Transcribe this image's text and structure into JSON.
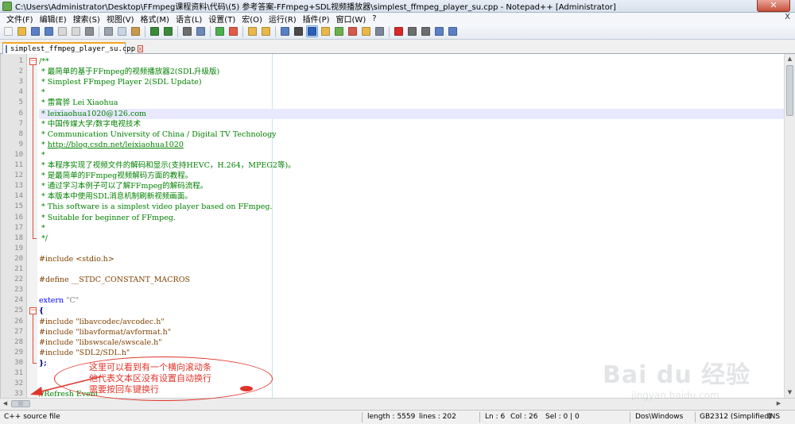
{
  "window": {
    "title": "C:\\Users\\Administrator\\Desktop\\FFmpeg课程资料\\代码\\(5) 参考答案-FFmpeg+SDL视频播放器\\simplest_ffmpeg_player_su.cpp - Notepad++ [Administrator]",
    "close_glyph": "✕"
  },
  "menu": {
    "items": [
      "文件(F)",
      "编辑(E)",
      "搜索(S)",
      "视图(V)",
      "格式(M)",
      "语言(L)",
      "设置(T)",
      "宏(O)",
      "运行(R)",
      "插件(P)",
      "窗口(W)",
      "?"
    ],
    "close_glyph": "X"
  },
  "toolbar": {
    "buttons": [
      {
        "icon": "new-file-icon",
        "color": "#f4f4f4"
      },
      {
        "icon": "open-file-icon",
        "color": "#e8b94a"
      },
      {
        "icon": "save-icon",
        "color": "#5b7fc4"
      },
      {
        "icon": "save-all-icon",
        "color": "#5b7fc4"
      },
      {
        "icon": "close-file-icon",
        "color": "#d8d8d8"
      },
      {
        "icon": "close-all-icon",
        "color": "#d8d8d8"
      },
      {
        "icon": "print-icon",
        "color": "#8a8f96"
      },
      {
        "sep": true
      },
      {
        "icon": "cut-icon",
        "color": "#9aa3ad"
      },
      {
        "icon": "copy-icon",
        "color": "#c8d4e4"
      },
      {
        "icon": "paste-icon",
        "color": "#c99a4e"
      },
      {
        "sep": true
      },
      {
        "icon": "undo-icon",
        "color": "#3a8a3a"
      },
      {
        "icon": "redo-icon",
        "color": "#3a8a3a"
      },
      {
        "sep": true
      },
      {
        "icon": "find-icon",
        "color": "#6d6d6d"
      },
      {
        "icon": "replace-icon",
        "color": "#6d87b8"
      },
      {
        "sep": true
      },
      {
        "icon": "zoom-in-icon",
        "color": "#4caf50"
      },
      {
        "icon": "zoom-out-icon",
        "color": "#e05a4a"
      },
      {
        "sep": true
      },
      {
        "icon": "sync-vertical-icon",
        "color": "#e8b94a"
      },
      {
        "icon": "sync-horizontal-icon",
        "color": "#e8b94a"
      },
      {
        "sep": true
      },
      {
        "icon": "word-wrap-icon",
        "color": "#5b7fc4"
      },
      {
        "icon": "show-all-chars-icon",
        "color": "#4a4a4a"
      },
      {
        "icon": "indent-guide-icon",
        "color": "#2d5fb8",
        "active": true
      },
      {
        "icon": "udl-icon",
        "color": "#e8b94a"
      },
      {
        "icon": "doc-map-icon",
        "color": "#6ab04c"
      },
      {
        "icon": "function-list-icon",
        "color": "#d85a4a"
      },
      {
        "icon": "folder-workspace-icon",
        "color": "#e8b94a"
      },
      {
        "icon": "monitoring-icon",
        "color": "#7b8796"
      },
      {
        "sep": true
      },
      {
        "icon": "record-macro-icon",
        "color": "#d62828"
      },
      {
        "icon": "stop-macro-icon",
        "color": "#6d6d6d"
      },
      {
        "icon": "play-macro-icon",
        "color": "#6d6d6d"
      },
      {
        "icon": "run-macro-multiple-icon",
        "color": "#5b7fc4"
      },
      {
        "icon": "save-macro-icon",
        "color": "#5b7fc4"
      }
    ]
  },
  "tab": {
    "label": "simplest_ffmpeg_player_su.cpp",
    "close_glyph": "x"
  },
  "editor": {
    "current_line": 6,
    "lines": [
      {
        "n": "1",
        "t": [
          [
            "c-comment",
            "/**"
          ]
        ]
      },
      {
        "n": "2",
        "t": [
          [
            "c-comment",
            " * 最简单的基于FFmpeg的视频播放器2(SDL升级版)"
          ]
        ]
      },
      {
        "n": "3",
        "t": [
          [
            "c-comment",
            " * Simplest FFmpeg Player 2(SDL Update)"
          ]
        ]
      },
      {
        "n": "4",
        "t": [
          [
            "c-comment",
            " *"
          ]
        ]
      },
      {
        "n": "5",
        "t": [
          [
            "c-comment",
            " * 雷霄骅 Lei Xiaohua"
          ]
        ]
      },
      {
        "n": "6",
        "t": [
          [
            "c-comment",
            " * leixiaohua1020@126.com"
          ]
        ]
      },
      {
        "n": "7",
        "t": [
          [
            "c-comment",
            " * 中国传媒大学/数字电视技术"
          ]
        ]
      },
      {
        "n": "8",
        "t": [
          [
            "c-comment",
            " * Communication University of China / Digital TV Technology"
          ]
        ]
      },
      {
        "n": "9",
        "t": [
          [
            "c-comment",
            " * "
          ],
          [
            "c-link",
            "http://blog.csdn.net/leixiaohua1020"
          ]
        ]
      },
      {
        "n": "10",
        "t": [
          [
            "c-comment",
            " *"
          ]
        ]
      },
      {
        "n": "11",
        "t": [
          [
            "c-comment",
            " * 本程序实现了视频文件的解码和显示(支持HEVC，H.264，MPEG2等)。"
          ]
        ]
      },
      {
        "n": "12",
        "t": [
          [
            "c-comment",
            " * 是最简单的FFmpeg视频解码方面的教程。"
          ]
        ]
      },
      {
        "n": "13",
        "t": [
          [
            "c-comment",
            " * 通过学习本例子可以了解FFmpeg的解码流程。"
          ]
        ]
      },
      {
        "n": "14",
        "t": [
          [
            "c-comment",
            " * 本版本中使用SDL消息机制刷新视频画面。"
          ]
        ]
      },
      {
        "n": "15",
        "t": [
          [
            "c-comment",
            " * This software is a simplest video player based on FFmpeg."
          ]
        ]
      },
      {
        "n": "16",
        "t": [
          [
            "c-comment",
            " * Suitable for beginner of FFmpeg."
          ]
        ]
      },
      {
        "n": "17",
        "t": [
          [
            "c-comment",
            " *"
          ]
        ]
      },
      {
        "n": "18",
        "t": [
          [
            "c-comment",
            " */"
          ]
        ]
      },
      {
        "n": "19",
        "t": []
      },
      {
        "n": "20",
        "t": [
          [
            "c-pre",
            "#include <stdio.h>"
          ]
        ]
      },
      {
        "n": "21",
        "t": []
      },
      {
        "n": "22",
        "t": [
          [
            "c-pre",
            "#define __STDC_CONSTANT_MACROS"
          ]
        ]
      },
      {
        "n": "23",
        "t": []
      },
      {
        "n": "24",
        "t": [
          [
            "c-kw",
            "extern "
          ],
          [
            "c-str",
            "\"C\""
          ]
        ]
      },
      {
        "n": "25",
        "t": [
          [
            "c-op",
            "{"
          ]
        ]
      },
      {
        "n": "26",
        "t": [
          [
            "c-pre",
            "#include \"libavcodec/avcodec.h\""
          ]
        ]
      },
      {
        "n": "27",
        "t": [
          [
            "c-pre",
            "#include \"libavformat/avformat.h\""
          ]
        ]
      },
      {
        "n": "28",
        "t": [
          [
            "c-pre",
            "#include \"libswscale/swscale.h\""
          ]
        ]
      },
      {
        "n": "29",
        "t": [
          [
            "c-pre",
            "#include \"SDL2/SDL.h\""
          ]
        ]
      },
      {
        "n": "30",
        "t": [
          [
            "c-op",
            "};"
          ]
        ]
      },
      {
        "n": "31",
        "t": []
      },
      {
        "n": "32",
        "t": []
      },
      {
        "n": "33",
        "t": [
          [
            "c-comment",
            "//Refresh Event"
          ]
        ]
      }
    ]
  },
  "annotation": {
    "lines": [
      "这里可以看到有一个横向滚动条",
      "他代表文本区没有设置自动换行",
      "需要按回车键换行"
    ],
    "color": "#e0342a"
  },
  "hscroll": {
    "grip": "|||"
  },
  "status": {
    "file_type": "C++ source file",
    "length": "length : 5559",
    "lines": "lines : 202",
    "ln": "Ln : 6",
    "col": "Col : 26",
    "sel": "Sel : 0 | 0",
    "eol": "Dos\\Windows",
    "encoding": "GB2312 (Simplified)",
    "mode": "INS"
  },
  "watermark": {
    "main": "Bai du 经验",
    "sub": "jingyan.baidu.com"
  }
}
